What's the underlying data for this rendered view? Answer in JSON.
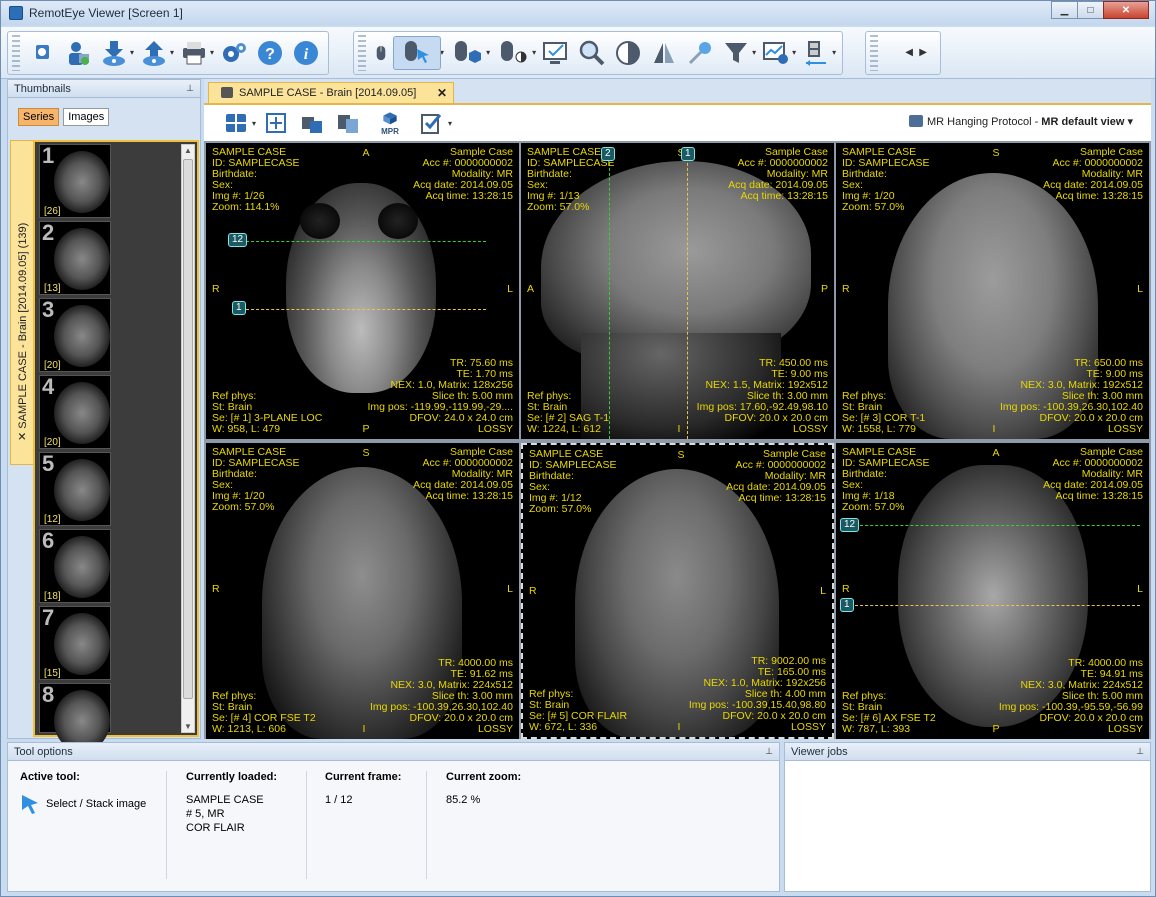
{
  "window": {
    "title": "RemotEye Viewer [Screen 1]"
  },
  "thumbnails_panel": {
    "title": "Thumbnails",
    "toggle_series": "Series",
    "toggle_images": "Images",
    "study_tab": "SAMPLE CASE - Brain [2014.09.05] (139)",
    "series": [
      {
        "num": "1",
        "count": "[26]"
      },
      {
        "num": "2",
        "count": "[13]"
      },
      {
        "num": "3",
        "count": "[20]"
      },
      {
        "num": "4",
        "count": "[20]"
      },
      {
        "num": "5",
        "count": "[12]"
      },
      {
        "num": "6",
        "count": "[18]"
      },
      {
        "num": "7",
        "count": "[15]"
      },
      {
        "num": "8",
        "count": ""
      }
    ]
  },
  "document_tab": {
    "label": "SAMPLE CASE - Brain [2014.09.05]"
  },
  "viewer_toolbar": {
    "mpr_label": "MPR",
    "hanging_protocol_label": "MR Hanging Protocol - ",
    "hanging_protocol_value": "MR default view"
  },
  "viewports": [
    {
      "tl": [
        "SAMPLE CASE",
        "ID: SAMPLECASE",
        "Birthdate:",
        "Sex:",
        "Img #: 1/26",
        "Zoom: 114.1%"
      ],
      "tr": [
        "Sample Case",
        "Acc #: 0000000002",
        "Modality: MR",
        "Acq date: 2014.09.05",
        "Acq time: 13:28:15"
      ],
      "bl": [
        "Ref phys:",
        "St: Brain",
        "Se: [# 1] 3-PLANE LOC",
        "W: 958, L: 479"
      ],
      "br": [
        "TR: 75.60 ms",
        "TE: 1.70 ms",
        "NEX: 1.0, Matrix: 128x256",
        "Slice th: 5.00 mm",
        "Img pos: -119.99,-119.99,-29....",
        "DFOV: 24.0 x 24.0 cm",
        "LOSSY"
      ],
      "n": "A",
      "s": "P",
      "w": "R",
      "e": "L",
      "tags": [
        "12",
        "1"
      ]
    },
    {
      "tl": [
        "SAMPLE CASE",
        "ID: SAMPLECASE",
        "Birthdate:",
        "Sex:",
        "Img #: 1/13",
        "Zoom: 57.0%"
      ],
      "tr": [
        "Sample Case",
        "Acc #: 0000000002",
        "Modality: MR",
        "Acq date: 2014.09.05",
        "Acq time: 13:28:15"
      ],
      "bl": [
        "Ref phys:",
        "St: Brain",
        "Se: [# 2] SAG T-1",
        "W: 1224, L: 612"
      ],
      "br": [
        "TR: 450.00 ms",
        "TE: 9.00 ms",
        "NEX: 1.5, Matrix: 192x512",
        "Slice th: 3.00 mm",
        "Img pos: 17.60,-92.49,98.10",
        "DFOV: 20.0 x 20.0 cm",
        "LOSSY"
      ],
      "n": "S",
      "s": "I",
      "w": "A",
      "e": "P",
      "tags": [
        "2",
        "1"
      ]
    },
    {
      "tl": [
        "SAMPLE CASE",
        "ID: SAMPLECASE",
        "Birthdate:",
        "Sex:",
        "Img #: 1/20",
        "Zoom: 57.0%"
      ],
      "tr": [
        "Sample Case",
        "Acc #: 0000000002",
        "Modality: MR",
        "Acq date: 2014.09.05",
        "Acq time: 13:28:15"
      ],
      "bl": [
        "Ref phys:",
        "St: Brain",
        "Se: [# 3] COR T-1",
        "W: 1558, L: 779"
      ],
      "br": [
        "TR: 650.00 ms",
        "TE: 9.00 ms",
        "NEX: 3.0, Matrix: 192x512",
        "Slice th: 3.00 mm",
        "Img pos: -100.39,26.30,102.40",
        "DFOV: 20.0 x 20.0 cm",
        "LOSSY"
      ],
      "n": "S",
      "s": "I",
      "w": "R",
      "e": "L",
      "tags": []
    },
    {
      "tl": [
        "SAMPLE CASE",
        "ID: SAMPLECASE",
        "Birthdate:",
        "Sex:",
        "Img #: 1/20",
        "Zoom: 57.0%"
      ],
      "tr": [
        "Sample Case",
        "Acc #: 0000000002",
        "Modality: MR",
        "Acq date: 2014.09.05",
        "Acq time: 13:28:15"
      ],
      "bl": [
        "Ref phys:",
        "St: Brain",
        "Se: [# 4] COR FSE T2",
        "W: 1213, L: 606"
      ],
      "br": [
        "TR: 4000.00 ms",
        "TE: 91.62 ms",
        "NEX: 3.0, Matrix: 224x512",
        "Slice th: 3.00 mm",
        "Img pos: -100.39,26.30,102.40",
        "DFOV: 20.0 x 20.0 cm",
        "LOSSY"
      ],
      "n": "S",
      "s": "I",
      "w": "R",
      "e": "L",
      "tags": []
    },
    {
      "tl": [
        "SAMPLE CASE",
        "ID: SAMPLECASE",
        "Birthdate:",
        "Sex:",
        "Img #: 1/12",
        "Zoom: 57.0%"
      ],
      "tr": [
        "Sample Case",
        "Acc #: 0000000002",
        "Modality: MR",
        "Acq date: 2014.09.05",
        "Acq time: 13:28:15"
      ],
      "bl": [
        "Ref phys:",
        "St: Brain",
        "Se: [# 5] COR FLAIR",
        "W: 672, L: 336"
      ],
      "br": [
        "TR: 9002.00 ms",
        "TE: 165.00 ms",
        "NEX: 1.0, Matrix: 192x256",
        "Slice th: 4.00 mm",
        "Img pos: -100.39,15.40,98.80",
        "DFOV: 20.0 x 20.0 cm",
        "LOSSY"
      ],
      "n": "S",
      "s": "I",
      "w": "R",
      "e": "L",
      "tags": []
    },
    {
      "tl": [
        "SAMPLE CASE",
        "ID: SAMPLECASE",
        "Birthdate:",
        "Sex:",
        "Img #: 1/18",
        "Zoom: 57.0%"
      ],
      "tr": [
        "Sample Case",
        "Acc #: 0000000002",
        "Modality: MR",
        "Acq date: 2014.09.05",
        "Acq time: 13:28:15"
      ],
      "bl": [
        "Ref phys:",
        "St: Brain",
        "Se: [# 6] AX FSE T2",
        "W: 787, L: 393"
      ],
      "br": [
        "TR: 4000.00 ms",
        "TE: 94.91 ms",
        "NEX: 3.0, Matrix: 224x512",
        "Slice th: 5.00 mm",
        "Img pos: -100.39,-95.59,-56.99",
        "DFOV: 20.0 x 20.0 cm",
        "LOSSY"
      ],
      "n": "A",
      "s": "P",
      "w": "R",
      "e": "L",
      "tags": [
        "12",
        "1"
      ]
    }
  ],
  "tool_options": {
    "title": "Tool options",
    "active_tool_label": "Active tool:",
    "active_tool_value": "Select / Stack image",
    "loaded_label": "Currently loaded:",
    "loaded_lines": [
      "SAMPLE CASE",
      "# 5, MR",
      "COR FLAIR"
    ],
    "frame_label": "Current frame:",
    "frame_value": "1 / 12",
    "zoom_label": "Current zoom:",
    "zoom_value": "85.2 %"
  },
  "viewer_jobs": {
    "title": "Viewer jobs"
  },
  "colors": {
    "overlay_text": "#e9d700",
    "highlight": "#fbe39a",
    "ref_green": "#35d035",
    "ref_yellow": "#e6c64a",
    "tag_bg": "#1b5a62"
  }
}
